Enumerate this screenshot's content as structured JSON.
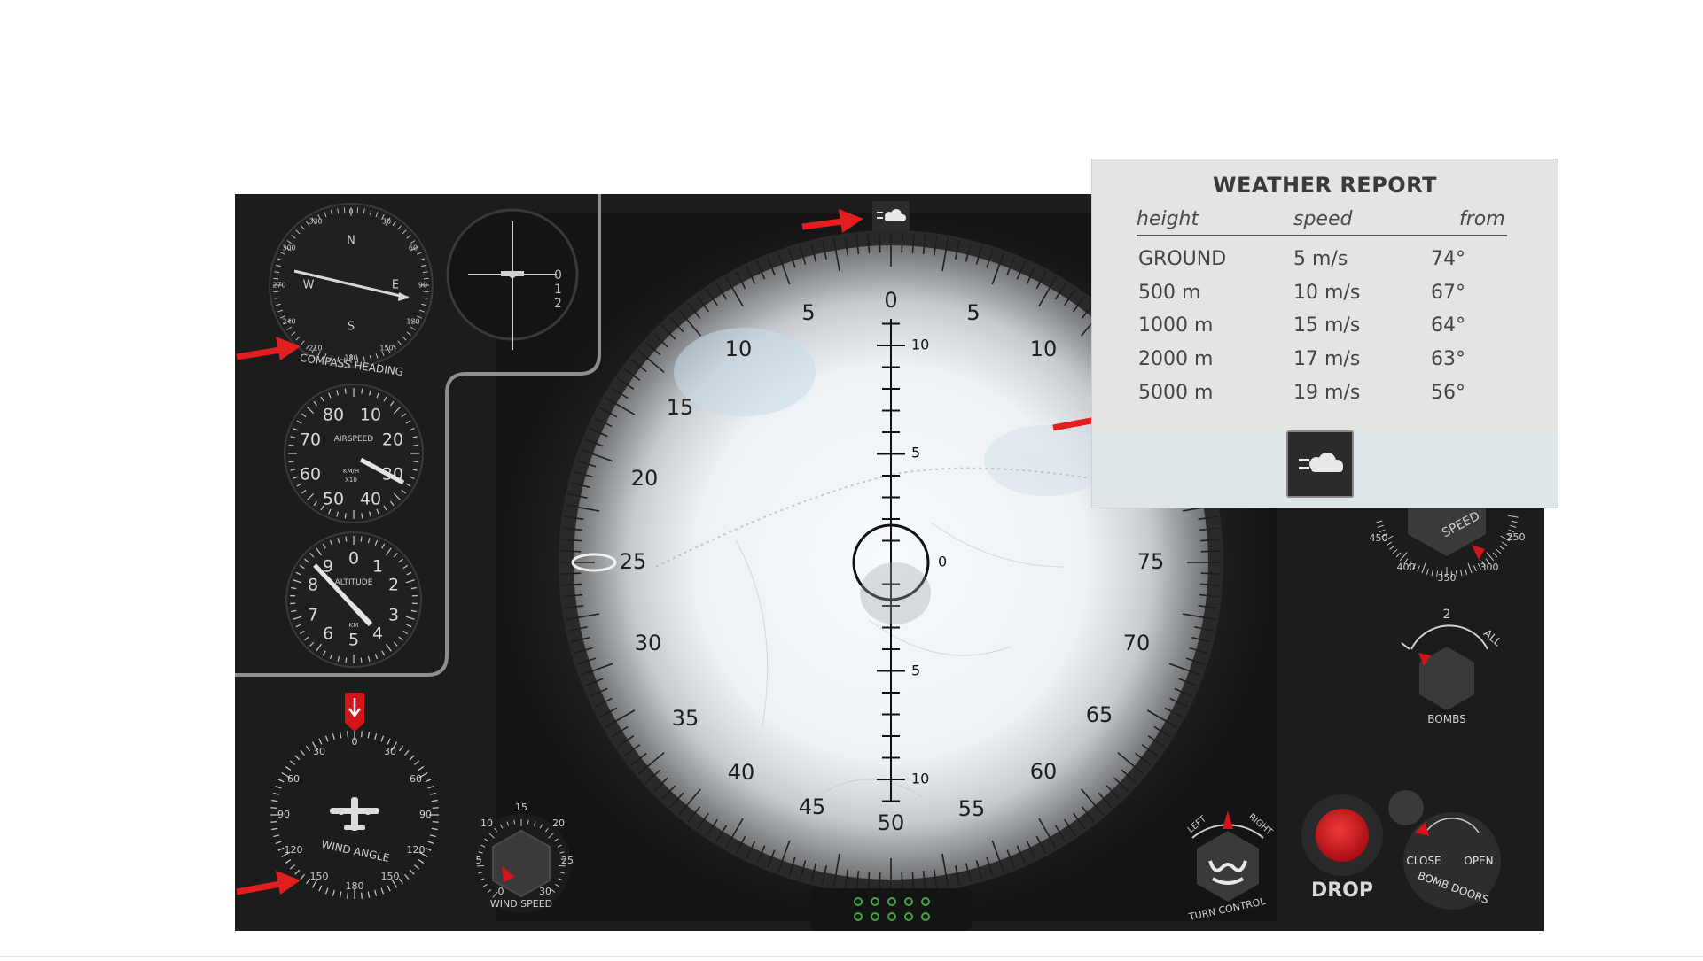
{
  "weather": {
    "title": "WEATHER REPORT",
    "headers": {
      "height": "height",
      "speed": "speed",
      "from": "from"
    },
    "rows": [
      {
        "height": "GROUND",
        "speed": "5 m/s",
        "from": "74°"
      },
      {
        "height": "500 m",
        "speed": "10 m/s",
        "from": "67°"
      },
      {
        "height": "1000 m",
        "speed": "15 m/s",
        "from": "64°"
      },
      {
        "height": "2000 m",
        "speed": "17 m/s",
        "from": "63°"
      },
      {
        "height": "5000 m",
        "speed": "19 m/s",
        "from": "56°"
      }
    ]
  },
  "compass": {
    "label": "COMPASS HEADING",
    "north": "N",
    "east": "E",
    "south": "S",
    "west": "W",
    "ticks": [
      "0",
      "30",
      "60",
      "90",
      "120",
      "150",
      "180",
      "210",
      "240",
      "270",
      "300",
      "330"
    ]
  },
  "airspeed": {
    "label": "AIRSPEED",
    "unit": "KM/H",
    "multiplier": "X10",
    "numbers": [
      "10",
      "20",
      "30",
      "40",
      "50",
      "60",
      "70",
      "80"
    ]
  },
  "altitude": {
    "label": "ALTITUDE",
    "unit": "KM",
    "numbers": [
      "0",
      "1",
      "2",
      "3",
      "4",
      "5",
      "6",
      "7",
      "8",
      "9"
    ]
  },
  "attitude": {
    "marks": [
      "0",
      "1",
      "2"
    ]
  },
  "wind_angle": {
    "label": "WIND ANGLE",
    "numbers": [
      "0",
      "30",
      "60",
      "90",
      "120",
      "150",
      "180",
      "150",
      "120",
      "90",
      "60",
      "30"
    ]
  },
  "wind_speed": {
    "label": "WIND SPEED",
    "numbers": [
      "0",
      "5",
      "10",
      "15",
      "20",
      "25",
      "30"
    ]
  },
  "sight": {
    "outer_numbers": [
      "0",
      "5",
      "10",
      "15",
      "20",
      "25",
      "30",
      "35",
      "40",
      "45",
      "50",
      "55",
      "60",
      "65",
      "70",
      "75"
    ],
    "center_mark": "0",
    "scale_marks": [
      "10",
      "5",
      "5",
      "10"
    ]
  },
  "bombs": {
    "label": "BOMBS",
    "count_mark": "2",
    "all_mark": "ALL"
  },
  "turn_control": {
    "label": "TURN CONTROL",
    "left": "LEFT",
    "right": "RIGHT"
  },
  "drop": {
    "label": "DROP"
  },
  "bomb_doors": {
    "label": "BOMB DOORS",
    "close": "CLOSE",
    "open": "OPEN"
  },
  "speed_gauge": {
    "label": "SPEED",
    "numbers": [
      "250",
      "300",
      "350",
      "400",
      "450"
    ]
  },
  "colors": {
    "panel": "#1c1c1c",
    "pointer_red": "#d4141b",
    "arrow_red": "#e41e1e",
    "drop_red": "#c4121a",
    "indicator_green": "#3fa93f"
  }
}
